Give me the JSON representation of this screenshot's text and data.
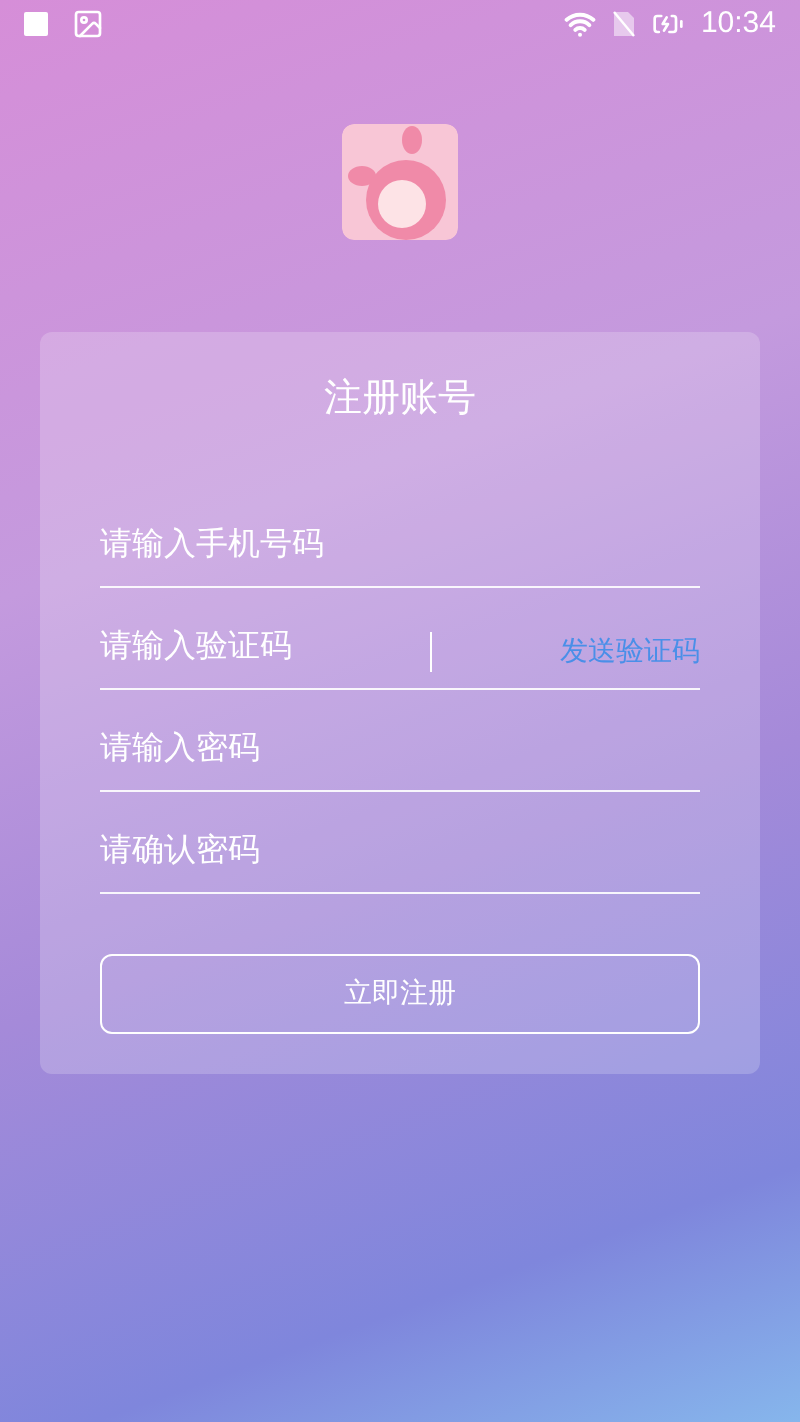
{
  "status_bar": {
    "time": "10:34"
  },
  "form": {
    "title": "注册账号",
    "fields": [
      {
        "kind": "text",
        "placeholder": "请输入手机号码"
      },
      {
        "kind": "code",
        "placeholder": "请输入验证码",
        "action": "发送验证码"
      },
      {
        "kind": "text",
        "placeholder": "请输入密码"
      },
      {
        "kind": "text",
        "placeholder": "请确认密码"
      }
    ],
    "submit": "立即注册"
  }
}
